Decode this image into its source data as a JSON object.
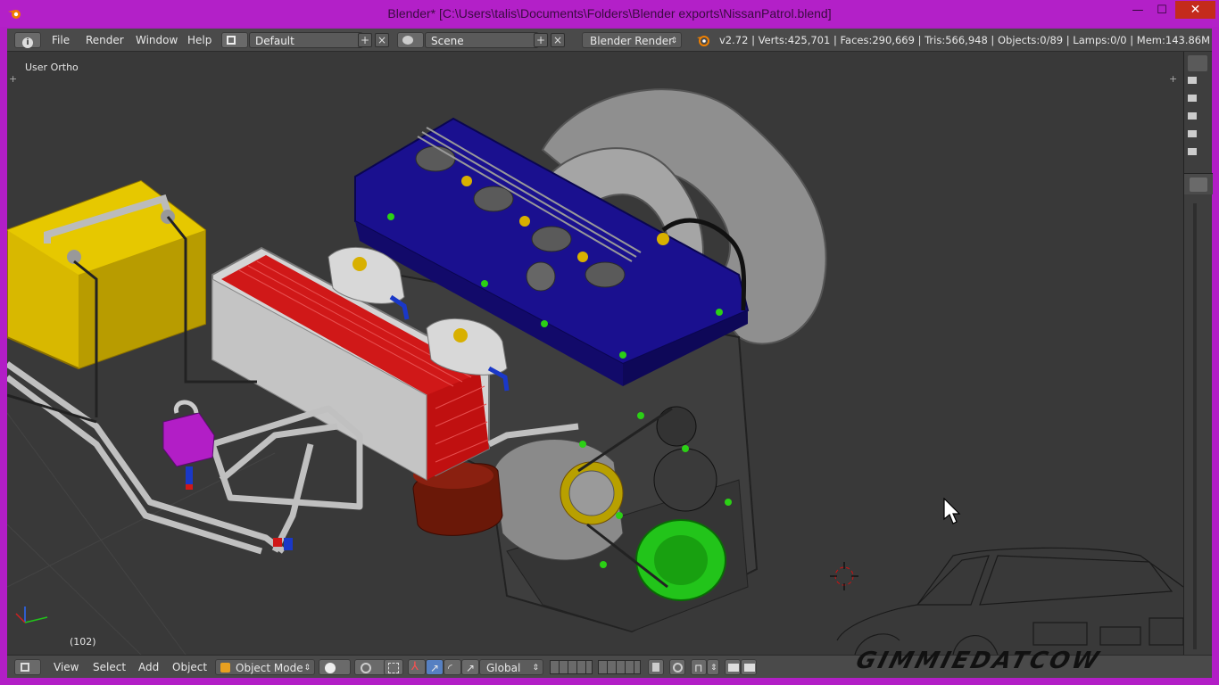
{
  "window": {
    "title": "Blender* [C:\\Users\\talis\\Documents\\Folders\\Blender exports\\NissanPatrol.blend]",
    "minimize_glyph": "—",
    "maximize_glyph": "☐",
    "close_glyph": "✕"
  },
  "info_header": {
    "menus": [
      "File",
      "Render",
      "Window",
      "Help"
    ],
    "layout": "Default",
    "scene": "Scene",
    "render_engine": "Blender Render",
    "stats": "v2.72 | Verts:425,701 | Faces:290,669 | Tris:566,948 | Objects:0/89 | Lamps:0/0 | Mem:143.86M"
  },
  "viewport": {
    "view_label": "User Ortho",
    "frame_label": "(102)"
  },
  "view3d_header": {
    "menus": [
      "View",
      "Select",
      "Add",
      "Object"
    ],
    "mode": "Object Mode",
    "orientation": "Global"
  },
  "watermark": "GIMMIEDATCOW",
  "colors": {
    "window_frame": "#b21ec6",
    "header_bg": "#4a4a4a",
    "viewport_bg": "#393939",
    "valve_cover": "#1a108f",
    "intercooler_fins": "#d01818",
    "battery": "#d8b800",
    "alternator": "#22c41a",
    "filter": "#6a1808",
    "manifold": "#9a9a9a"
  }
}
